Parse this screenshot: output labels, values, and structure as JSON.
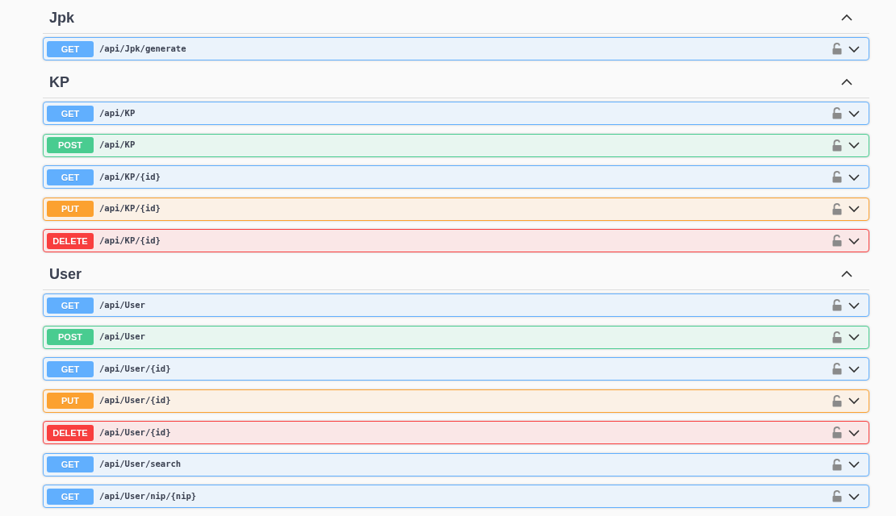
{
  "sections": [
    {
      "name": "Jpk",
      "expanded": true,
      "operations": [
        {
          "kind": "get",
          "method": "GET",
          "path": "/api/Jpk/generate",
          "expanded": false
        }
      ]
    },
    {
      "name": "KP",
      "expanded": true,
      "operations": [
        {
          "kind": "get",
          "method": "GET",
          "path": "/api/KP",
          "expanded": false
        },
        {
          "kind": "post",
          "method": "POST",
          "path": "/api/KP",
          "expanded": false
        },
        {
          "kind": "get",
          "method": "GET",
          "path": "/api/KP/{id}",
          "expanded": false
        },
        {
          "kind": "put",
          "method": "PUT",
          "path": "/api/KP/{id}",
          "expanded": false
        },
        {
          "kind": "delete",
          "method": "DELETE",
          "path": "/api/KP/{id}",
          "expanded": false
        }
      ]
    },
    {
      "name": "User",
      "expanded": true,
      "operations": [
        {
          "kind": "get",
          "method": "GET",
          "path": "/api/User",
          "expanded": false
        },
        {
          "kind": "post",
          "method": "POST",
          "path": "/api/User",
          "expanded": false
        },
        {
          "kind": "get",
          "method": "GET",
          "path": "/api/User/{id}",
          "expanded": false
        },
        {
          "kind": "put",
          "method": "PUT",
          "path": "/api/User/{id}",
          "expanded": false
        },
        {
          "kind": "delete",
          "method": "DELETE",
          "path": "/api/User/{id}",
          "expanded": false
        },
        {
          "kind": "get",
          "method": "GET",
          "path": "/api/User/search",
          "expanded": false
        },
        {
          "kind": "get",
          "method": "GET",
          "path": "/api/User/nip/{nip}",
          "expanded": false
        }
      ]
    }
  ]
}
